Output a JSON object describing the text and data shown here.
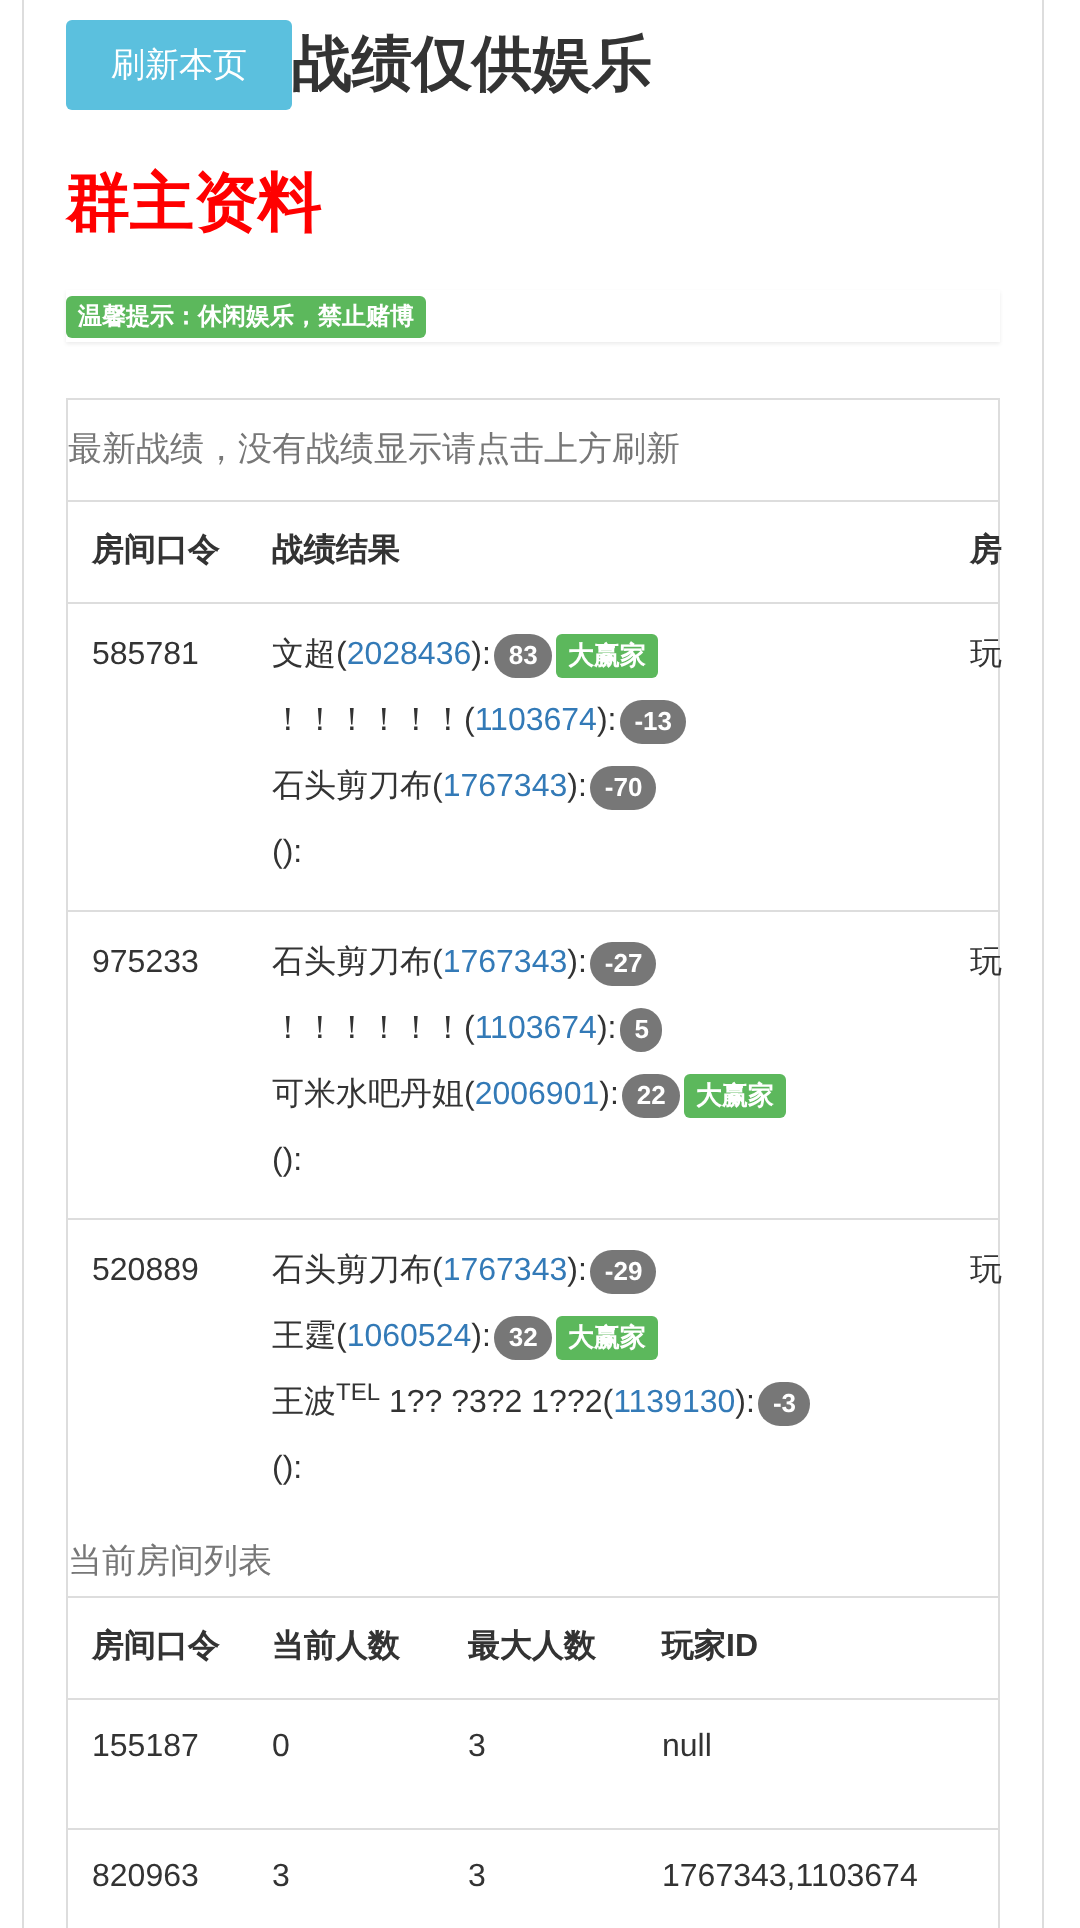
{
  "header": {
    "refresh_button": "刷新本页",
    "title": "战绩仅供娱乐"
  },
  "owner_heading": "群主资料",
  "notice": "温馨提示：休闲娱乐，禁止赌博",
  "results": {
    "caption": "最新战绩，没有战绩显示请点击上方刷新",
    "columns": [
      "房间口令",
      "战绩结果",
      "房"
    ],
    "rows": [
      {
        "room": "585781",
        "column_3": "玩",
        "players": [
          {
            "kind": "player",
            "prefix": "文超(",
            "id": "2028436",
            "suffix": "):",
            "score": "83",
            "winner": true,
            "winner_label": "大赢家"
          },
          {
            "kind": "player",
            "prefix": "！！！！！！(",
            "id": "1103674",
            "suffix": "):",
            "score": "-13",
            "winner": false
          },
          {
            "kind": "player",
            "prefix": "石头剪刀布(",
            "id": "1767343",
            "suffix": "):",
            "score": "-70",
            "winner": false
          },
          {
            "kind": "blank",
            "prefix": "():"
          }
        ]
      },
      {
        "room": "975233",
        "column_3": "玩",
        "players": [
          {
            "kind": "player",
            "prefix": "石头剪刀布(",
            "id": "1767343",
            "suffix": "):",
            "score": "-27",
            "winner": false
          },
          {
            "kind": "player",
            "prefix": "！！！！！！(",
            "id": "1103674",
            "suffix": "):",
            "score": "5",
            "winner": false
          },
          {
            "kind": "player",
            "prefix": "可米水吧丹姐(",
            "id": "2006901",
            "suffix": "):",
            "score": "22",
            "winner": true,
            "winner_label": "大赢家"
          },
          {
            "kind": "blank",
            "prefix": "():"
          }
        ]
      },
      {
        "room": "520889",
        "column_3": "玩",
        "players": [
          {
            "kind": "player",
            "prefix": "石头剪刀布(",
            "id": "1767343",
            "suffix": "):",
            "score": "-29",
            "winner": false
          },
          {
            "kind": "player",
            "prefix": "王霆(",
            "id": "1060524",
            "suffix": "):",
            "score": "32",
            "winner": true,
            "winner_label": "大赢家"
          },
          {
            "kind": "player",
            "prefix": "王波$^{TEL}$ 1?? ?3?2 1??2(",
            "id": "1139130",
            "suffix": "):",
            "score": "-3",
            "winner": false
          },
          {
            "kind": "blank",
            "prefix": "():"
          }
        ]
      }
    ]
  },
  "rooms": {
    "caption": "当前房间列表",
    "columns": [
      "房间口令",
      "当前人数",
      "最大人数",
      "玩家ID"
    ],
    "rows": [
      [
        "155187",
        "0",
        "3",
        "null"
      ],
      [
        "820963",
        "3",
        "3",
        "1767343,1103674"
      ]
    ]
  }
}
